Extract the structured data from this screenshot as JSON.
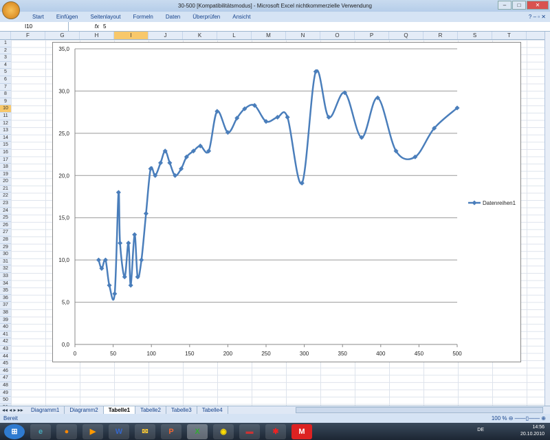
{
  "window": {
    "title": "30-500  [Kompatibilitätsmodus] - Microsoft Excel nichtkommerzielle Verwendung"
  },
  "menu": [
    "Start",
    "Einfügen",
    "Seitenlayout",
    "Formeln",
    "Daten",
    "Überprüfen",
    "Ansicht"
  ],
  "formula": {
    "cell": "I10",
    "fx": "fx",
    "value": "5"
  },
  "columns": [
    "F",
    "G",
    "H",
    "I",
    "J",
    "K",
    "L",
    "M",
    "N",
    "O",
    "P",
    "Q",
    "R",
    "S",
    "T"
  ],
  "selected_column": "I",
  "selected_row": 10,
  "rows": 51,
  "sheets": [
    "Diagramm1",
    "Diagramm2",
    "Tabelle1",
    "Tabelle2",
    "Tabelle3",
    "Tabelle4"
  ],
  "active_sheet": "Tabelle1",
  "status": "Bereit",
  "zoom": "100 %",
  "tray": {
    "lang": "DE",
    "time": "14:56",
    "date": "20.10.2010"
  },
  "chart_data": {
    "type": "line",
    "title": "",
    "xlabel": "",
    "ylabel": "",
    "xlim": [
      0,
      500
    ],
    "ylim": [
      0,
      35
    ],
    "xticks": [
      "0",
      "50",
      "100",
      "150",
      "200",
      "250",
      "300",
      "350",
      "400",
      "450",
      "500"
    ],
    "yticks": [
      "0,0",
      "5,0",
      "10,0",
      "15,0",
      "20,0",
      "25,0",
      "30,0",
      "35,0"
    ],
    "grid": true,
    "legend": "right",
    "color": "#4a7ebb",
    "series": [
      {
        "name": "Datenreihen1",
        "x": [
          31,
          35,
          40,
          45,
          52,
          57,
          59,
          65,
          70,
          73,
          78,
          82,
          87,
          93,
          99,
          105,
          112,
          118,
          124,
          131,
          139,
          146,
          155,
          164,
          175,
          186,
          200,
          212,
          222,
          235,
          250,
          265,
          278,
          297,
          315,
          332,
          353,
          375,
          396,
          420,
          445,
          470,
          500
        ],
        "y": [
          10,
          9,
          10,
          7,
          6,
          18,
          12,
          8,
          12,
          7,
          13,
          8,
          10,
          15.5,
          20.8,
          20,
          21.5,
          22.9,
          21.5,
          20,
          20.8,
          22.2,
          22.9,
          23.5,
          22.9,
          27.6,
          25.1,
          26.8,
          27.9,
          28.3,
          26.4,
          26.9,
          26.9,
          19.1,
          32.3,
          26.9,
          29.8,
          24.5,
          29.2,
          22.9,
          22.2,
          25.6,
          28
        ]
      }
    ]
  }
}
